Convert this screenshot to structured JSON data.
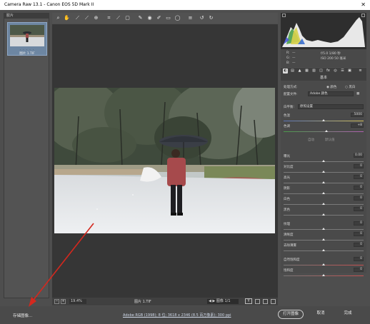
{
  "window": {
    "title": "Camera Raw 13.1 - Canon EOS 5D Mark II",
    "close_glyph": "✕"
  },
  "filmstrip": {
    "header": "胶片",
    "thumbnail": {
      "stars": "· · · · ·",
      "filename": "图片 1.TIF"
    }
  },
  "toolbar": {
    "icons": [
      "zoom-icon",
      "hand-icon",
      "white-balance-icon",
      "color-sampler-icon",
      "target-adjust-icon",
      "crop-icon",
      "straighten-icon",
      "transform-icon",
      "spot-removal-icon",
      "red-eye-icon",
      "adjustment-brush-icon",
      "graduated-filter-icon",
      "radial-filter-icon",
      "preferences-icon",
      "rotate-left-icon",
      "rotate-right-icon"
    ]
  },
  "canvas_status": {
    "zoom_minus": "−",
    "zoom_plus": "+",
    "zoom": "19.4%",
    "filename": "图片 1.TIF",
    "nav": "◀ ▶ 图像 1/1",
    "y_button": "Y"
  },
  "camera_info": {
    "r_label": "R:",
    "g_label": "G:",
    "b_label": "B:",
    "dash": "—",
    "line1": "f/5.0  1/80 秒",
    "line2": "ISO 200  50 毫米"
  },
  "panel": {
    "title": "基本",
    "tab_icons": [
      "basic-icon",
      "tone-curve-icon",
      "detail-icon",
      "hsl-icon",
      "split-toning-icon",
      "lens-icon",
      "fx-icon",
      "calibration-icon",
      "presets-icon",
      "snapshots-icon"
    ],
    "process_label": "处理方式:",
    "process_color": "颜色",
    "process_bw": "黑白",
    "profile_label": "配置文件:",
    "profile_value": "Adobe 颜色",
    "wb_label": "白平衡:",
    "wb_value": "原照设置",
    "temp_label": "色温",
    "temp_value": "5000",
    "tint_label": "色调",
    "tint_value": "+8",
    "auto": "自动",
    "default": "默认值",
    "sliders": [
      {
        "label": "曝光",
        "value": "0.00"
      },
      {
        "label": "对比度",
        "value": "0"
      },
      {
        "label": "高光",
        "value": "0"
      },
      {
        "label": "阴影",
        "value": "0"
      },
      {
        "label": "白色",
        "value": "0"
      },
      {
        "label": "黑色",
        "value": "0"
      },
      {
        "label": "纹理",
        "value": "0"
      },
      {
        "label": "清晰度",
        "value": "0"
      },
      {
        "label": "去除薄雾",
        "value": "0"
      },
      {
        "label": "自然饱和度",
        "value": "0"
      },
      {
        "label": "饱和度",
        "value": "0"
      }
    ]
  },
  "bottombar": {
    "save": "存储图像...",
    "workflow_link": "Adobe RGB (1998); 8 位; 3618 x 2346 (8.5 百万像素); 300 ppi",
    "open": "打开图像",
    "cancel": "取消",
    "done": "完成"
  },
  "colors": {
    "app_bg": "#4e4e4e",
    "canvas_bg": "#363636",
    "annotation_arrow": "#d4281e",
    "tint_track": "#7b5a8c",
    "histogram_fill": "#e8e8e8"
  }
}
